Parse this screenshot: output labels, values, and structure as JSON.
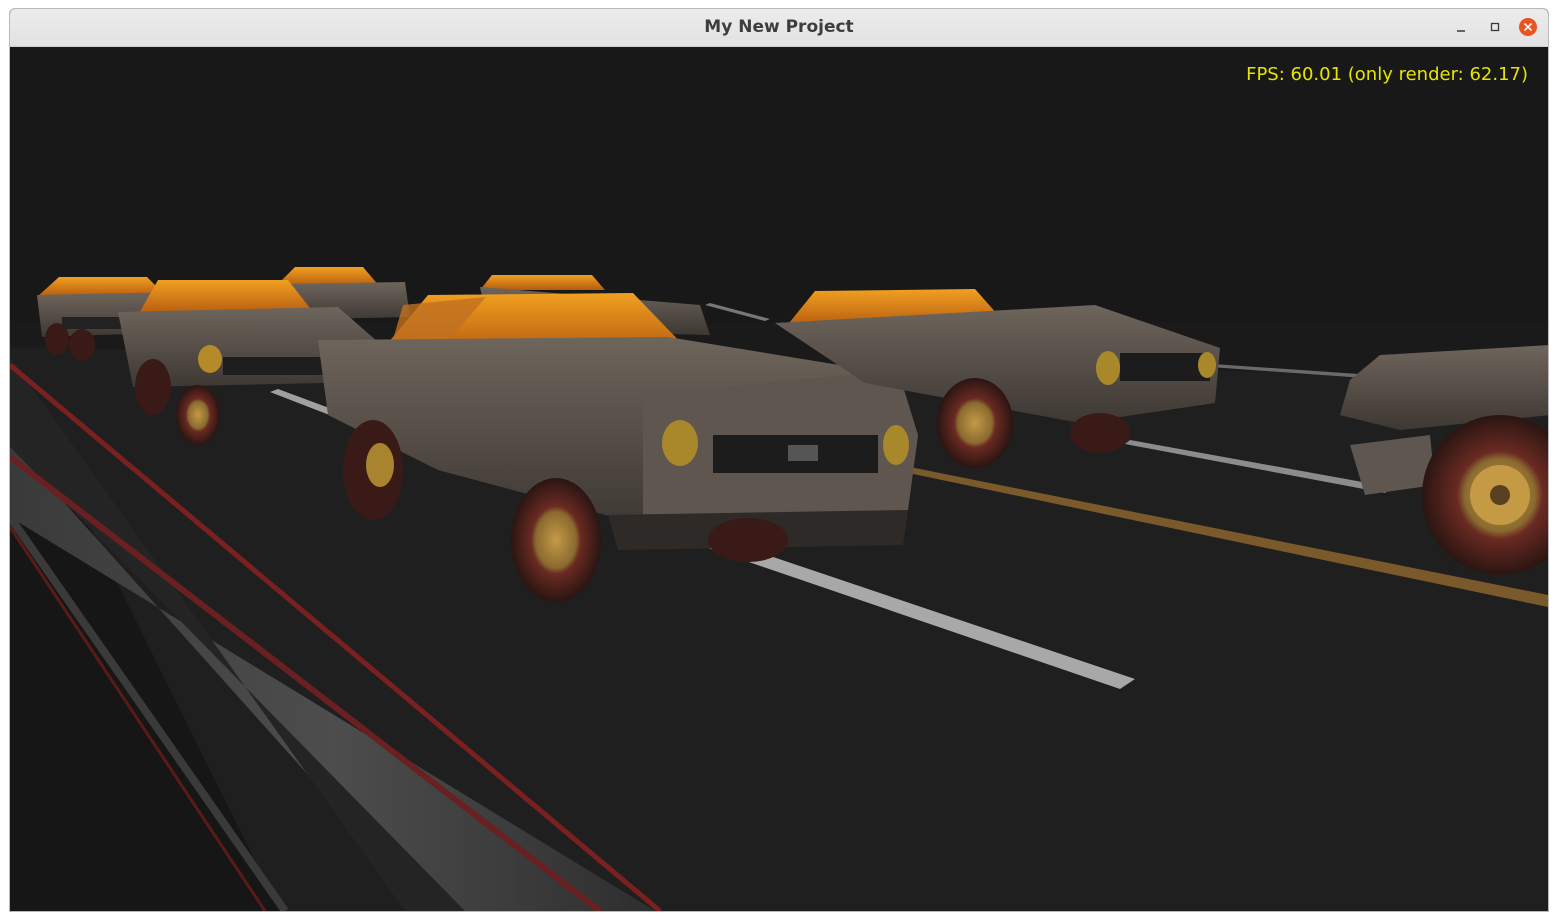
{
  "window": {
    "title": "My New Project",
    "buttons": {
      "minimize": "minimize-icon",
      "maximize": "maximize-icon",
      "close": "close-icon"
    },
    "close_color": "#e95420"
  },
  "overlay": {
    "fps_text": "FPS: 60.01 (only render: 62.17)",
    "fps_color": "#e5e500"
  },
  "scene": {
    "background_color": "#181818",
    "road_color": "#1e1e1e",
    "car_count": 7
  }
}
